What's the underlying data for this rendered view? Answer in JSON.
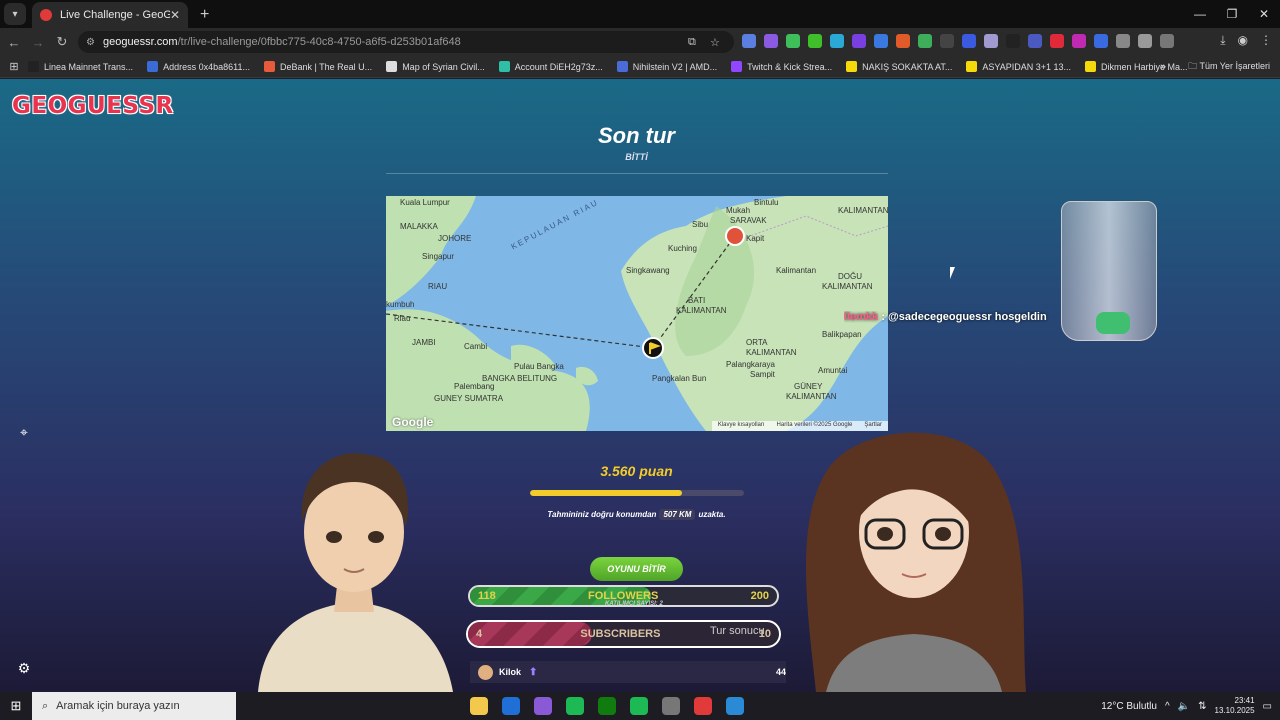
{
  "browser": {
    "tab_title": "Live Challenge - GeoGuessr",
    "url_domain": "geoguessr.com",
    "url_path": "/tr/live-challenge/0fbbc775-40c8-4750-a6f5-d253b01af648",
    "bookmarks": [
      {
        "label": "Linea Mainnet Trans...",
        "color": "#222222"
      },
      {
        "label": "Address 0x4ba8611...",
        "color": "#3b6bd6"
      },
      {
        "label": "DeBank | The Real U...",
        "color": "#e85a3c"
      },
      {
        "label": "Map of Syrian Civil...",
        "color": "#dddddd"
      },
      {
        "label": "Account DiEH2g73z...",
        "color": "#2fbfa6"
      },
      {
        "label": "Nihilstein V2 | AMD...",
        "color": "#4b6bd6"
      },
      {
        "label": "Twitch & Kick Strea...",
        "color": "#9146ff"
      },
      {
        "label": "NAKIŞ SOKAKTA AT...",
        "color": "#f5d90a"
      },
      {
        "label": "ASYAPIDAN 3+1 13...",
        "color": "#f5d90a"
      },
      {
        "label": "Dikmen Harbiye Ma...",
        "color": "#f5d90a"
      }
    ],
    "bookmarks_all": "Tüm Yer İşaretleri"
  },
  "page": {
    "logo": "GEOGUESSR",
    "heading": "Son tur",
    "subheading": "BİTTİ",
    "score": "3.560 puan",
    "score_fraction": 0.71,
    "distance_prefix": "Tahmininiz doğru konumdan",
    "distance_value": "507 KM",
    "distance_suffix": "uzakta.",
    "end_button": "OYUNU BİTİR",
    "participants_label": "KATILIMCI SAYISI: 2",
    "round_result": "Tur sonucu",
    "player_name": "Kilok",
    "player_points": "44",
    "chat_user": "llemkk",
    "chat_message": ": @sadecegeoguessr hosgeldin"
  },
  "overlay": {
    "followers_current": "118",
    "followers_label": "FOLLOWERS",
    "followers_goal": "200",
    "followers_fraction": 0.59,
    "subscribers_current": "4",
    "subscribers_label": "SUBSCRIBERS",
    "subscribers_goal": "10",
    "subscribers_fraction": 0.4
  },
  "map": {
    "labels": [
      "Kuala Lumpur",
      "MALAKKA",
      "JOHORE",
      "Singapur",
      "RIAU",
      "kumbuh",
      "Riau",
      "JAMBI",
      "Cambi",
      "Pulau Bangka",
      "BANGKA BELITUNG",
      "Palembang",
      "GUNEY SUMATRA",
      "Sibu",
      "Mukah",
      "SARAVAK",
      "Kuching",
      "Kapit",
      "Bintulu",
      "KALIMANTAN",
      "Singkawang",
      "BATI",
      "KALIMANTAN",
      "Kalimantan",
      "DOĞU",
      "KALIMANTAN",
      "Balikpapan",
      "ORTA",
      "KALIMANTAN",
      "Palangkaraya",
      "Sampit",
      "Amuntai",
      "GÜNEY",
      "KALIMANTAN",
      "Pangkalan Bun",
      "KEPULAUAN RIAU"
    ],
    "footer": [
      "Klavye kısayolları",
      "Harita verileri ©2025 Google",
      "Şartlar"
    ],
    "google": "Google"
  },
  "taskbar": {
    "search_placeholder": "Aramak için buraya yazın",
    "weather": "12°C  Bulutlu",
    "time": "23:41",
    "date": "13.10.2025"
  }
}
